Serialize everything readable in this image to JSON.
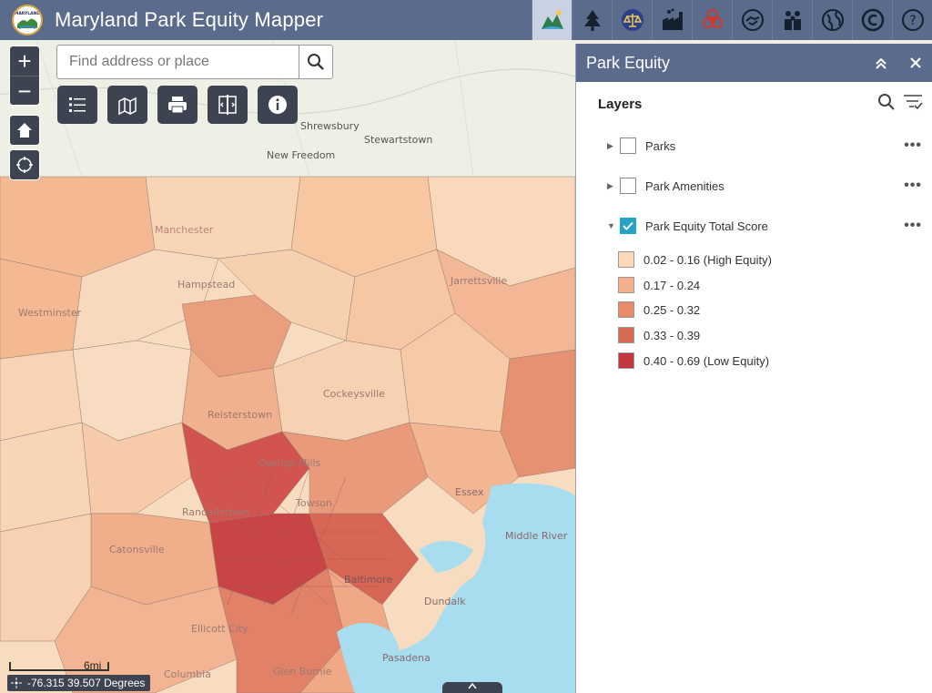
{
  "header": {
    "title": "Maryland Park Equity Mapper",
    "logo_text": "MARYLAND",
    "icons": [
      "park-equity-icon",
      "tree-icon",
      "justice-scale-icon",
      "factory-icon",
      "biohazard-icon",
      "handshake-icon",
      "people-icon",
      "globe-icon",
      "copyright-icon",
      "help-icon"
    ]
  },
  "map": {
    "search_placeholder": "Find address or place",
    "zoom_in": "+",
    "zoom_out": "−",
    "scale_label": "6mi",
    "coordinates": "-76.315 39.507 Degrees",
    "place_labels": [
      "Shrewsbury",
      "Stewartstown",
      "New Freedom",
      "Manchester",
      "Hampstead",
      "Westminster",
      "Reisterstown",
      "Owings Mills",
      "Randallstown",
      "Cockeysville",
      "Jarrettsville",
      "Middle River",
      "Essex",
      "Columbia",
      "Ellicott City",
      "Catonsville",
      "Dundalk",
      "Pasadena",
      "Glen Burnie",
      "Towson",
      "Baltimore"
    ]
  },
  "panel": {
    "title": "Park Equity",
    "layers_title": "Layers",
    "layers": [
      {
        "name": "Parks",
        "checked": false
      },
      {
        "name": "Park Amenities",
        "checked": false
      },
      {
        "name": "Park Equity Total Score",
        "checked": true
      }
    ],
    "legend": [
      {
        "label": "0.02 - 0.16 (High Equity)",
        "color": "#fbd9b8"
      },
      {
        "label": "0.17 - 0.24",
        "color": "#f4b08c"
      },
      {
        "label": "0.25 - 0.32",
        "color": "#e88c6c"
      },
      {
        "label": "0.33 - 0.39",
        "color": "#d96a52"
      },
      {
        "label": "0.40 - 0.69 (Low Equity)",
        "color": "#c1393c"
      }
    ]
  },
  "colors": {
    "header": "#5a6b8c",
    "map_button": "#3d4350",
    "water": "#a8dcef",
    "checkbox": "#24a3c7"
  }
}
